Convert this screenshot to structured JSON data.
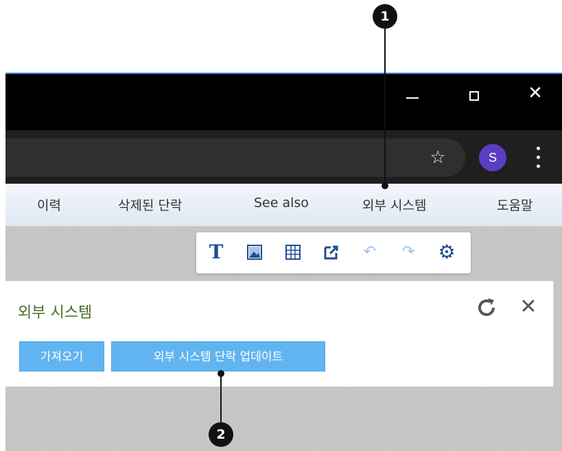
{
  "window": {
    "min_icon": "minimize-icon",
    "max_icon": "maximize-icon",
    "close_label": "✕"
  },
  "browser": {
    "star_icon": "star-icon",
    "avatar_letter": "S",
    "menu_icon": "kebab-menu-icon",
    "avatar_color": "#5b3dc4"
  },
  "nav": {
    "items": [
      {
        "label": "이력"
      },
      {
        "label": "삭제된 단락"
      },
      {
        "label": "See also"
      },
      {
        "label": "외부 시스템"
      },
      {
        "label": "도움말"
      }
    ]
  },
  "toolbar": {
    "tools": [
      {
        "name": "text-icon",
        "glyph": "T"
      },
      {
        "name": "image-icon",
        "glyph": ""
      },
      {
        "name": "table-icon",
        "glyph": ""
      },
      {
        "name": "export-icon",
        "glyph": ""
      },
      {
        "name": "undo-icon",
        "glyph": "↶"
      },
      {
        "name": "redo-icon",
        "glyph": "↷"
      },
      {
        "name": "settings-icon",
        "glyph": "⚙"
      }
    ]
  },
  "panel": {
    "title": "외부 시스템",
    "reload_icon": "reload-icon",
    "close_label": "✕",
    "buttons": {
      "import": "가져오기",
      "update": "외부 시스템 단락 업데이트"
    },
    "button_color": "#62b4f0"
  },
  "callouts": {
    "one": "1",
    "two": "2"
  }
}
